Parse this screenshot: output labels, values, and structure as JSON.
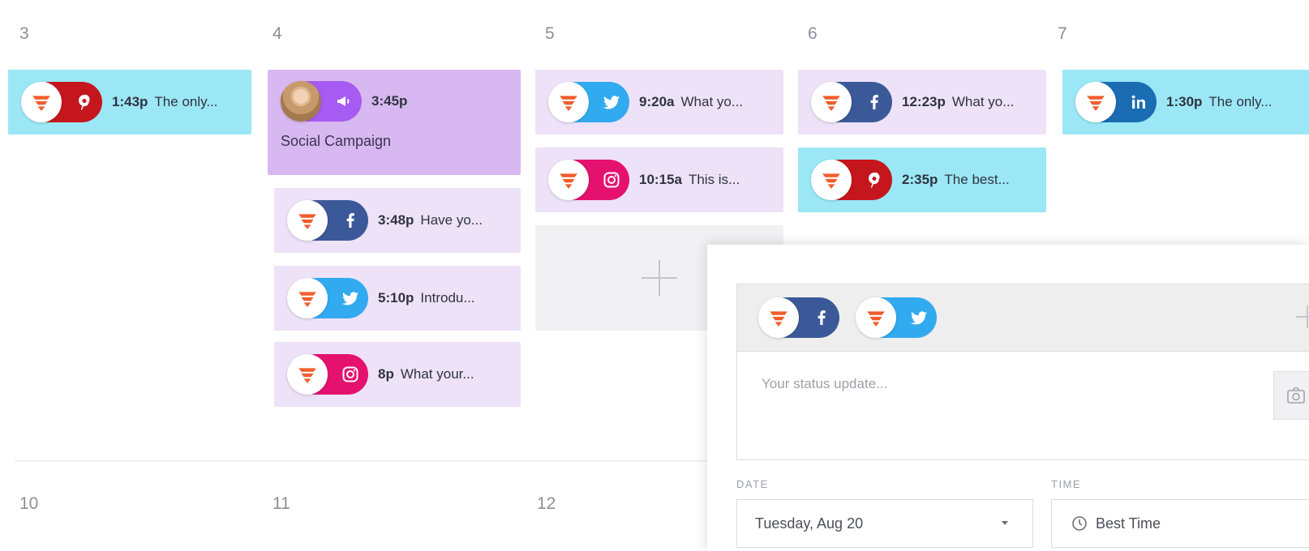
{
  "colors": {
    "pinterest": "#c4161c",
    "facebook": "#3b5998",
    "twitter": "#32aaf0",
    "instagram": "#e5116f",
    "linkedin": "#1a6db3",
    "campaign": "#a65bf2",
    "brand": "#f25c2b"
  },
  "week1": {
    "days": [
      "3",
      "4",
      "5",
      "6",
      "7"
    ],
    "cards": {
      "d3_1": {
        "time": "1:43p",
        "title": "The only...",
        "network": "pinterest"
      },
      "d4_campaign": {
        "time": "3:45p",
        "label": "Social Campaign",
        "network": "campaign"
      },
      "d4_2": {
        "time": "3:48p",
        "title": "Have yo...",
        "network": "facebook"
      },
      "d4_3": {
        "time": "5:10p",
        "title": "Introdu...",
        "network": "twitter"
      },
      "d4_4": {
        "time": "8p",
        "title": "What your...",
        "network": "instagram"
      },
      "d5_1": {
        "time": "9:20a",
        "title": "What yo...",
        "network": "twitter"
      },
      "d5_2": {
        "time": "10:15a",
        "title": "This is...",
        "network": "instagram"
      },
      "d6_1": {
        "time": "12:23p",
        "title": "What yo...",
        "network": "facebook"
      },
      "d6_2": {
        "time": "2:35p",
        "title": "The best...",
        "network": "pinterest"
      },
      "d7_1": {
        "time": "1:30p",
        "title": "The only...",
        "network": "linkedin"
      }
    }
  },
  "week2": {
    "days": [
      "10",
      "11",
      "12"
    ]
  },
  "composer": {
    "status_placeholder": "Your status update...",
    "date_label": "DATE",
    "date_value": "Tuesday, Aug 20",
    "time_label": "TIME",
    "time_value": "Best Time",
    "selected_profiles": [
      "facebook",
      "twitter"
    ]
  }
}
